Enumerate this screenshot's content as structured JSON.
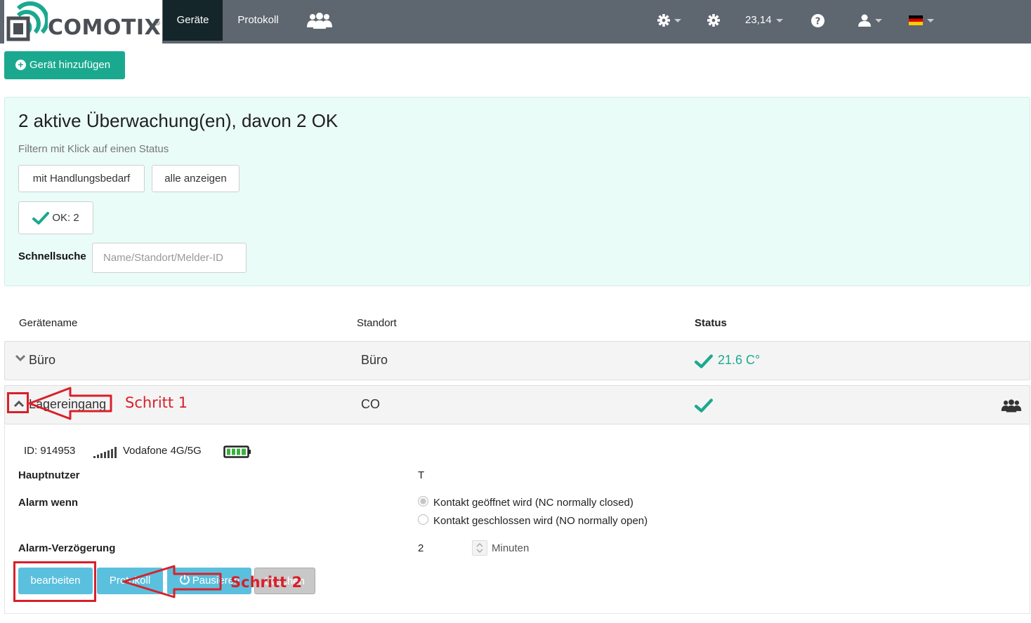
{
  "nav": {
    "brand": "COMOTIX",
    "brand_reg": "®",
    "tabs": [
      {
        "label": "Geräte",
        "active": true
      },
      {
        "label": "Protokoll",
        "active": false
      }
    ],
    "credit": "23,14",
    "accent_color": "#1aa98f",
    "navbar_color": "#5e6670"
  },
  "add_button": {
    "label": "Gerät hinzufügen"
  },
  "summary": {
    "title": "2 aktive Überwachung(en), davon 2 OK",
    "filter_hint": "Filtern mit Klick auf einen Status",
    "filter_action": "mit Handlungsbedarf",
    "filter_all": "alle anzeigen",
    "filter_ok": "OK: 2",
    "search_label": "Schnellsuche",
    "search_placeholder": "Name/Standort/Melder-ID"
  },
  "table": {
    "headers": {
      "name": "Gerätename",
      "location": "Standort",
      "status": "Status"
    },
    "rows": [
      {
        "name": "Büro",
        "location": "Büro",
        "status": "21.6 C°",
        "expanded": false
      },
      {
        "name": "Lagereingang",
        "location": "CO",
        "status": "",
        "expanded": true
      }
    ]
  },
  "details": {
    "id": "ID: 914953",
    "network": "Vodafone 4G/5G",
    "main_user_label": "Hauptnutzer",
    "main_user_value": "T",
    "alarm_label": "Alarm wenn",
    "alarm_option_1": "Kontakt geöffnet wird (NC normally closed)",
    "alarm_option_2": "Kontakt geschlossen wird (NO normally open)",
    "delay_label": "Alarm-Verzögerung",
    "delay_value": "2",
    "delay_unit": "Minuten",
    "btn_edit": "bearbeiten",
    "btn_protocol": "Protokoll",
    "btn_pause": "Pausieren",
    "btn_delete": "Löschen"
  },
  "annotations": {
    "step1": "Schritt 1",
    "step2": "Schritt 2"
  }
}
